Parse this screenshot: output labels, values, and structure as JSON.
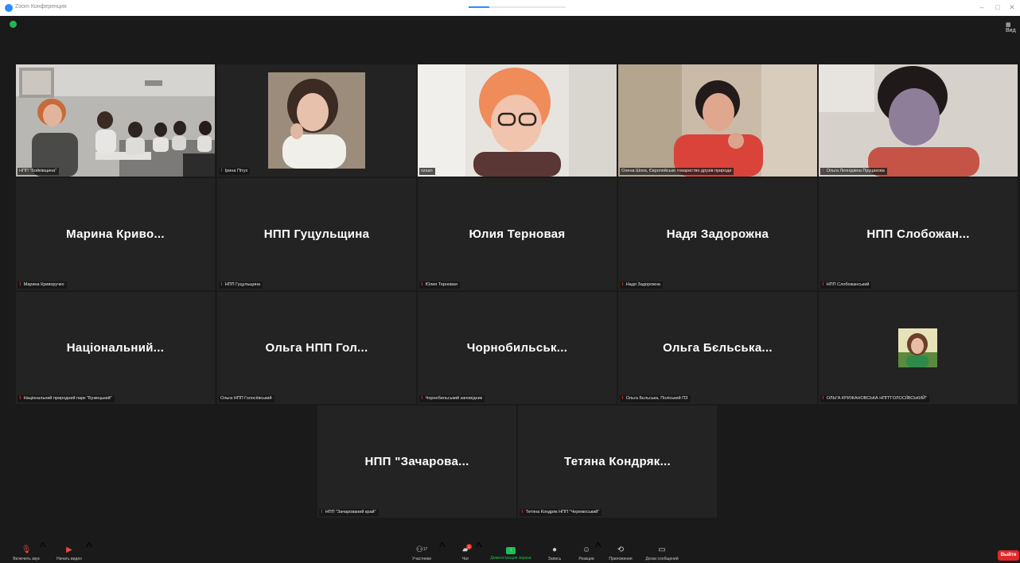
{
  "window": {
    "title": "Zoom Конференция",
    "minimize_glyph": "–",
    "maximize_glyph": "□",
    "close_glyph": "✕"
  },
  "top": {
    "view_label": "Вид"
  },
  "tiles": [
    {
      "label": "НПП \"Бойківщина\"",
      "type": "video",
      "muted": false
    },
    {
      "label": "Ірина Пітух",
      "type": "video",
      "muted": true
    },
    {
      "label": "ozsan",
      "type": "video",
      "muted": false
    },
    {
      "label": "Олена Шока, Європейське товариство друзів природи",
      "type": "video",
      "muted": false
    },
    {
      "label": "Ольга Леонідівна Пруцакова",
      "type": "video",
      "muted": true
    },
    {
      "display_name": "Марина Криво...",
      "label": "Марина Криворучко",
      "muted": true
    },
    {
      "display_name": "НПП Гуцульщина",
      "label": "НПП Гуцульщина",
      "muted": true
    },
    {
      "display_name": "Юлия Терновая",
      "label": "Юлия Терновая",
      "muted": true
    },
    {
      "display_name": "Надя Задорожна",
      "label": "Надя Задорожна",
      "muted": true
    },
    {
      "display_name": "НПП Слобожан...",
      "label": "НПП Слобожанський",
      "muted": true
    },
    {
      "display_name": "Національний...",
      "label": "Національний природний парк \"Бужецький\"",
      "muted": true
    },
    {
      "display_name": "Ольга НПП Гол...",
      "label": "Ольга НПП Голосіївський",
      "muted": false
    },
    {
      "display_name": "Чорнобильськ...",
      "label": "Чорнобильський заповідник",
      "muted": true
    },
    {
      "display_name": "Ольга Бєльська...",
      "label": "Ольга Бєльська, Поліський ПЗ",
      "muted": true
    },
    {
      "label": "ОЛЬГА КРИЖАНОВСЬКА НПП\"ГОЛОСІЇВСЬКИЙ\"",
      "type": "avatar",
      "muted": true
    },
    {
      "display_name": "НПП \"Зачарова...",
      "label": "НПП \"Зачарований край\"",
      "muted": true
    },
    {
      "display_name": "Тетяна Кондряк...",
      "label": "Тетяна Кондряк НПП \"Черемоський\"",
      "muted": true
    }
  ],
  "toolbar": {
    "unmute": "Включить звук",
    "start_video": "Начать видео",
    "participants": "Участники",
    "participants_count": "17",
    "chat": "Чат",
    "chat_badge": "1",
    "share": "Демонстрация экрана",
    "record": "Запись",
    "reactions": "Реакции",
    "apps": "Приложения",
    "whiteboard": "Доски сообщений",
    "leave": "Выйти"
  },
  "colors": {
    "background": "#1a1a1a",
    "tile": "#232323",
    "active_speaker": "#d8dc52",
    "share_green": "#1fbd52",
    "leave_red": "#e02828",
    "muted_red": "#ff3b30"
  }
}
